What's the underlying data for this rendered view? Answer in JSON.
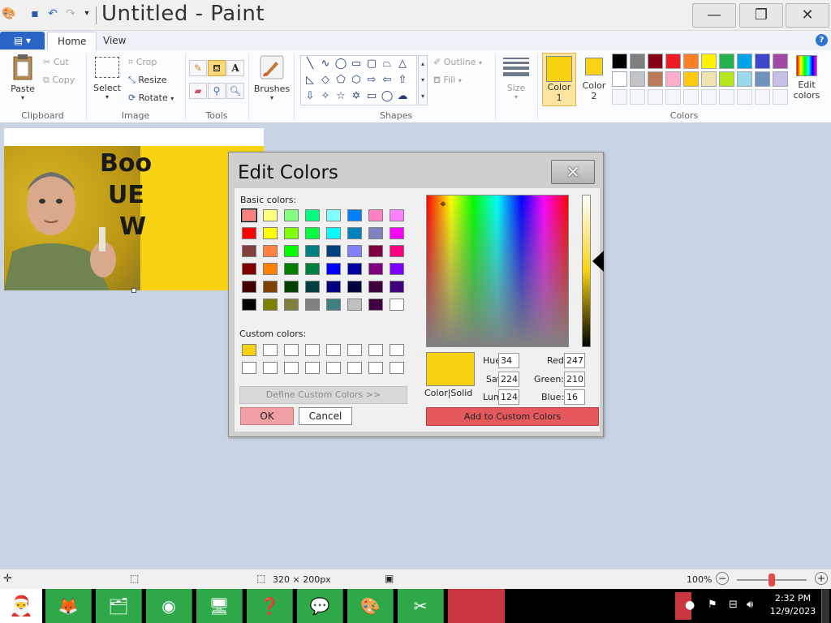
{
  "app": {
    "title": "Untitled - Paint",
    "file_tab": "▤ ▾",
    "tabs": [
      "Home",
      "View"
    ]
  },
  "ribbon": {
    "clipboard": {
      "paste": "Paste",
      "cut": "Cut",
      "copy": "Copy",
      "label": "Clipboard"
    },
    "image": {
      "select": "Select",
      "crop": "Crop",
      "resize": "Resize",
      "rotate": "Rotate",
      "label": "Image"
    },
    "tools": {
      "label": "Tools"
    },
    "brushes": {
      "label": "Brushes"
    },
    "shapes": {
      "outline": "Outline",
      "fill": "Fill",
      "label": "Shapes"
    },
    "size": {
      "label": "Size"
    },
    "colors": {
      "color1": "Color 1",
      "color2": "Color 2",
      "edit_colors": "Edit colors",
      "label": "Colors",
      "color1_value": "#f7d210",
      "color2_value": "#fbd21a",
      "palette": [
        "#000000",
        "#7f7f7f",
        "#880015",
        "#ed1c24",
        "#ff7f27",
        "#fff200",
        "#22b14c",
        "#00a2e8",
        "#3f48cc",
        "#a349a4",
        "#ffffff",
        "#c3c3c3",
        "#b97a57",
        "#ffaec9",
        "#ffc90e",
        "#efe4b0",
        "#b5e61d",
        "#99d9ea",
        "#7092be",
        "#c8bfe7"
      ]
    }
  },
  "canvas": {
    "heading_line1": "Boo",
    "heading_line2": "UE",
    "heading_line3": "W"
  },
  "dialog": {
    "title": "Edit Colors",
    "basic_label": "Basic colors:",
    "custom_label": "Custom colors:",
    "basic_colors": [
      "#ff8080",
      "#ffff80",
      "#80ff80",
      "#00ff80",
      "#80ffff",
      "#0080ff",
      "#ff80c0",
      "#ff80ff",
      "#ff0000",
      "#ffff00",
      "#80ff00",
      "#00ff40",
      "#00ffff",
      "#0080c0",
      "#8080c0",
      "#ff00ff",
      "#804040",
      "#ff8040",
      "#00ff00",
      "#008080",
      "#004080",
      "#8080ff",
      "#800040",
      "#ff0080",
      "#800000",
      "#ff8000",
      "#008000",
      "#008040",
      "#0000ff",
      "#0000a0",
      "#800080",
      "#8000ff",
      "#400000",
      "#804000",
      "#004000",
      "#004040",
      "#000080",
      "#000040",
      "#400040",
      "#400080",
      "#000000",
      "#808000",
      "#808040",
      "#808080",
      "#408080",
      "#c0c0c0",
      "#400040",
      "#ffffff"
    ],
    "custom_first": "#f7d210",
    "define_btn": "Define Custom Colors >>",
    "ok": "OK",
    "cancel": "Cancel",
    "color_solid": "Color|Solid",
    "hue_label": "Hue:",
    "hue": "34",
    "sat_label": "Sat:",
    "sat": "224",
    "lum_label": "Lum:",
    "lum": "124",
    "red_label": "Red:",
    "red": "247",
    "green_label": "Green:",
    "green": "210",
    "blue_label": "Blue:",
    "blue": "16",
    "add_custom": "Add to Custom Colors"
  },
  "status": {
    "dimensions": "320 × 200px",
    "zoom": "100%"
  },
  "taskbar": {
    "time": "2:32 PM",
    "date": "12/9/2023"
  }
}
